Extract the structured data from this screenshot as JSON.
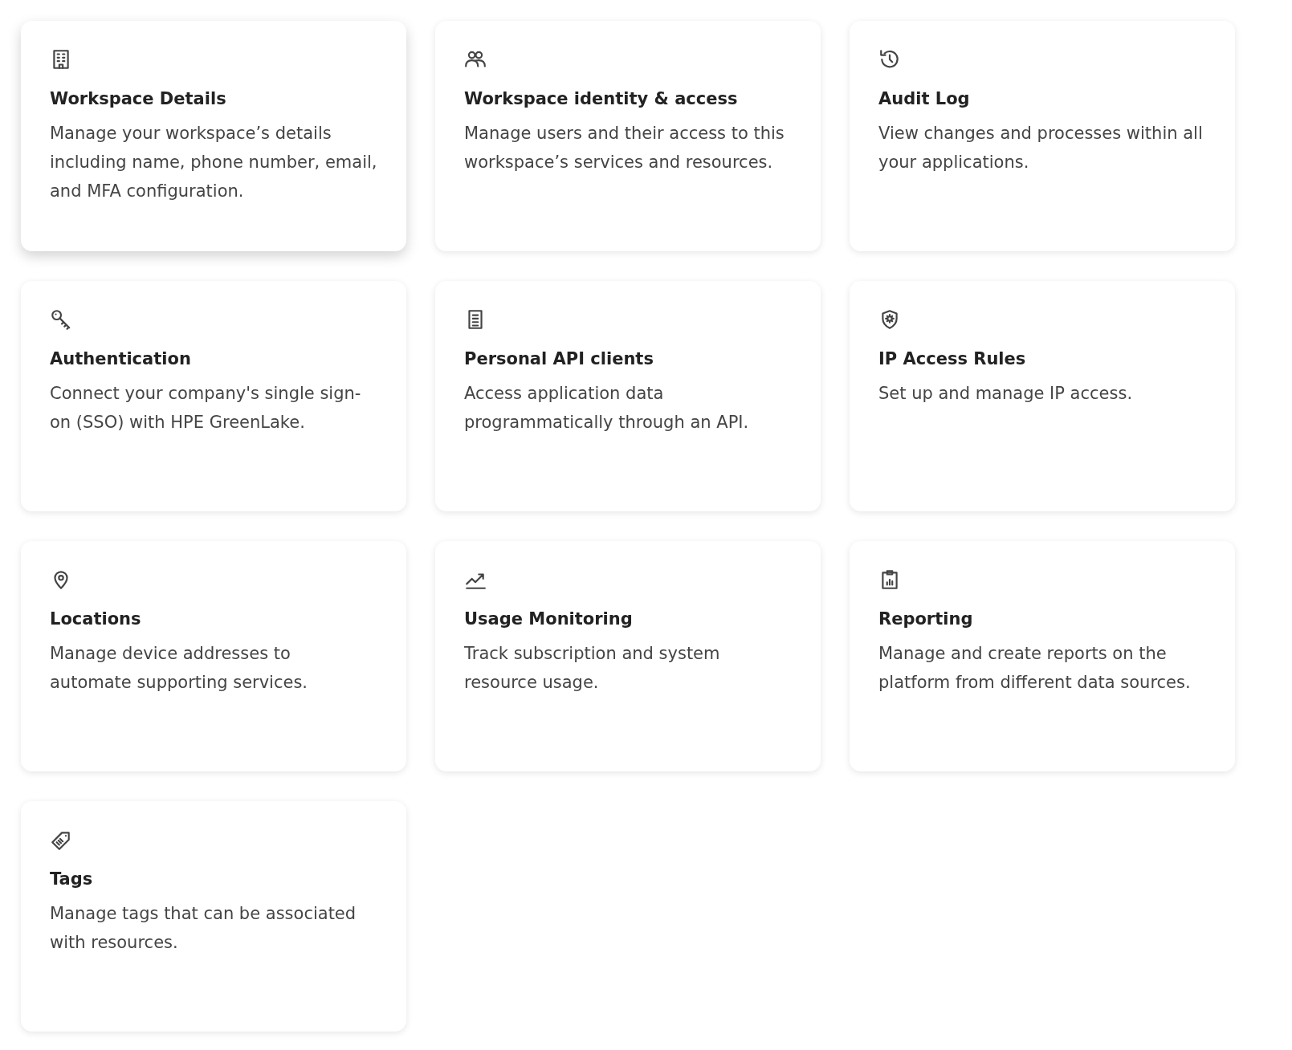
{
  "cards": [
    {
      "kind": "building",
      "title": "Workspace Details",
      "description": "Manage your workspace’s details including name, phone number, email, and MFA configuration.",
      "hovered": true
    },
    {
      "kind": "users",
      "title": "Workspace identity & access",
      "description": "Manage users and their access to this workspace’s services and resources.",
      "hovered": false
    },
    {
      "kind": "history",
      "title": "Audit Log",
      "description": "View changes and processes within all your applications.",
      "hovered": false
    },
    {
      "kind": "key",
      "title": "Authentication",
      "description": "Connect your company's single sign-on (SSO) with HPE GreenLake.",
      "hovered": false
    },
    {
      "kind": "document",
      "title": "Personal API clients",
      "description": "Access application data programmatically through an API.",
      "hovered": false
    },
    {
      "kind": "shield",
      "title": "IP Access Rules",
      "description": "Set up and manage IP access.",
      "hovered": false
    },
    {
      "kind": "location",
      "title": "Locations",
      "description": "Manage device addresses to automate supporting services.",
      "hovered": false
    },
    {
      "kind": "chart",
      "title": "Usage Monitoring",
      "description": "Track subscription and system resource usage.",
      "hovered": false
    },
    {
      "kind": "clipboard",
      "title": "Reporting",
      "description": "Manage and create reports on the platform from different data sources.",
      "hovered": false
    },
    {
      "kind": "tag",
      "title": "Tags",
      "description": "Manage tags that can be associated with resources.",
      "hovered": false
    }
  ]
}
